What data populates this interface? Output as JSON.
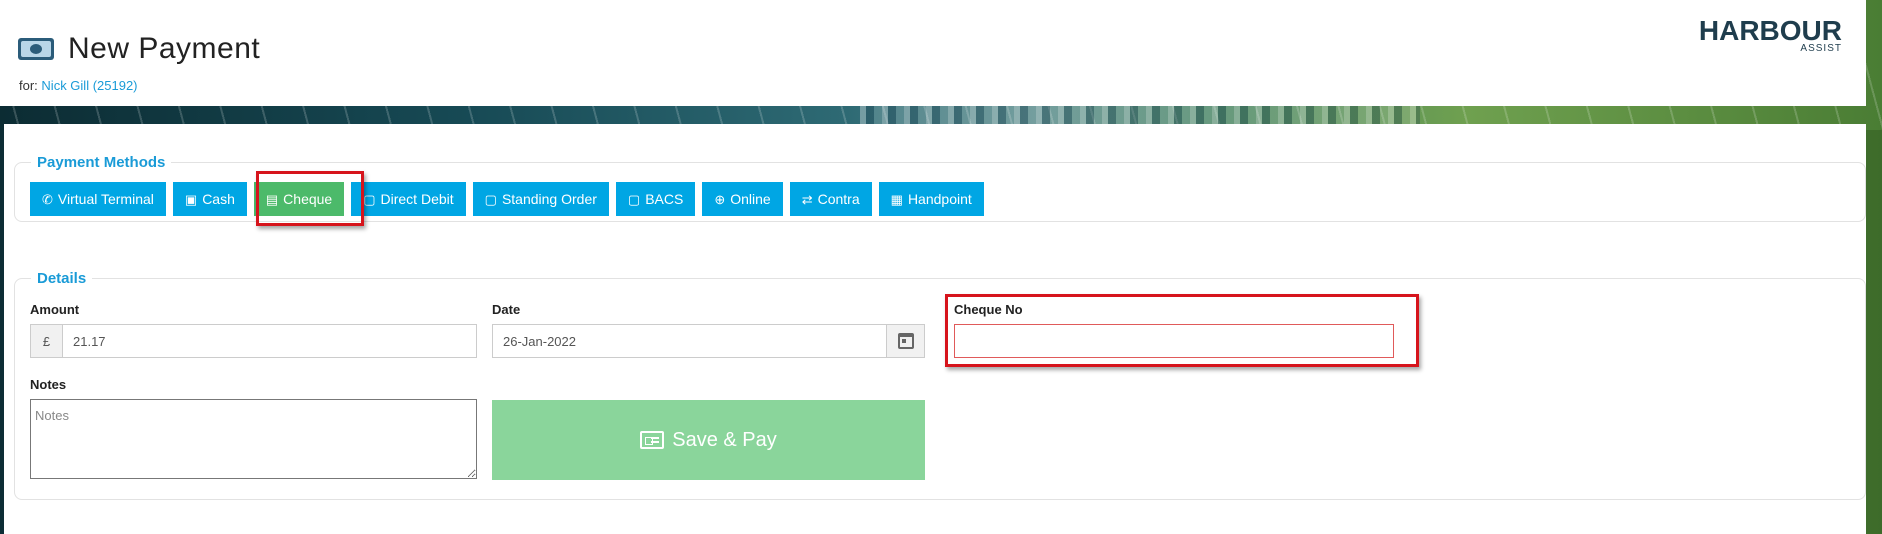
{
  "header": {
    "title": "New Payment",
    "for_prefix": "for:",
    "customer_link": "Nick Gill (25192)",
    "logo_main": "HARBOUR",
    "logo_sub": "ASSIST"
  },
  "payment_methods": {
    "legend": "Payment Methods",
    "buttons": [
      {
        "label": "Virtual Terminal",
        "icon": "phone-icon",
        "glyph": "✆"
      },
      {
        "label": "Cash",
        "icon": "money-icon",
        "glyph": "▣"
      },
      {
        "label": "Cheque",
        "icon": "card-icon",
        "glyph": "▤",
        "active": true
      },
      {
        "label": "Direct Debit",
        "icon": "calendar-icon",
        "glyph": "▢"
      },
      {
        "label": "Standing Order",
        "icon": "calendar-icon",
        "glyph": "▢"
      },
      {
        "label": "BACS",
        "icon": "calendar-icon",
        "glyph": "▢"
      },
      {
        "label": "Online",
        "icon": "globe-icon",
        "glyph": "⊕"
      },
      {
        "label": "Contra",
        "icon": "exchange-icon",
        "glyph": "⇄"
      },
      {
        "label": "Handpoint",
        "icon": "calculator-icon",
        "glyph": "▦"
      }
    ]
  },
  "details": {
    "legend": "Details",
    "amount_label": "Amount",
    "currency_symbol": "£",
    "amount_value": "21.17",
    "date_label": "Date",
    "date_value": "26-Jan-2022",
    "cheque_label": "Cheque No",
    "cheque_value": "",
    "notes_label": "Notes",
    "notes_placeholder": "Notes",
    "save_label": "Save & Pay"
  },
  "colors": {
    "primary": "#00a6e4",
    "active": "#4cba6a",
    "save": "#8ad59b",
    "legend": "#1a9bd7",
    "highlight": "#d6141c"
  }
}
